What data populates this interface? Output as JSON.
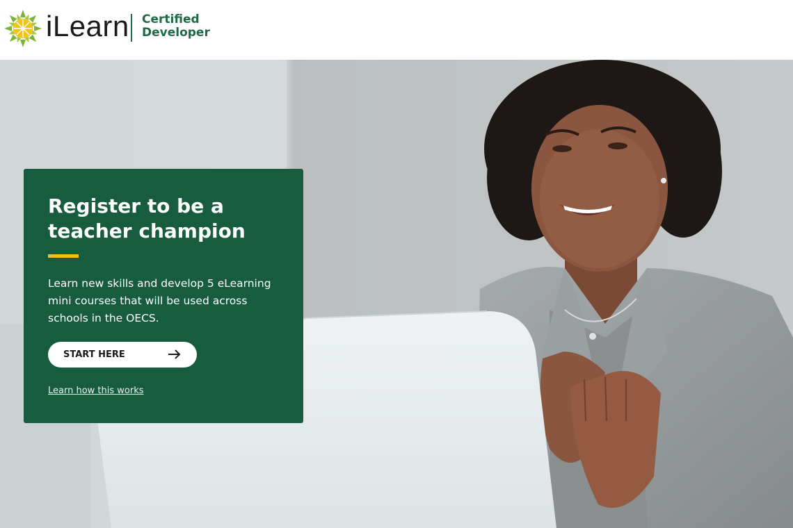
{
  "brand": {
    "logo_text": "iLearn",
    "certified_line1": "Certified",
    "certified_line2": "Developer"
  },
  "hero": {
    "title": "Register to be a teacher champion",
    "description": "Learn new skills and develop 5 eLearning mini courses that will be used across schools in the OECS.",
    "cta_label": "START HERE",
    "learn_link": "Learn how this works"
  },
  "icons": {
    "logo": "sun-icon",
    "cta": "arrow-right-icon"
  },
  "colors": {
    "card_green": "#175c3f",
    "accent_yellow": "#f2bf1b",
    "brand_green": "#1f6a45",
    "logo_sun_yellow": "#f0c419",
    "logo_sun_green": "#7bb33a"
  }
}
